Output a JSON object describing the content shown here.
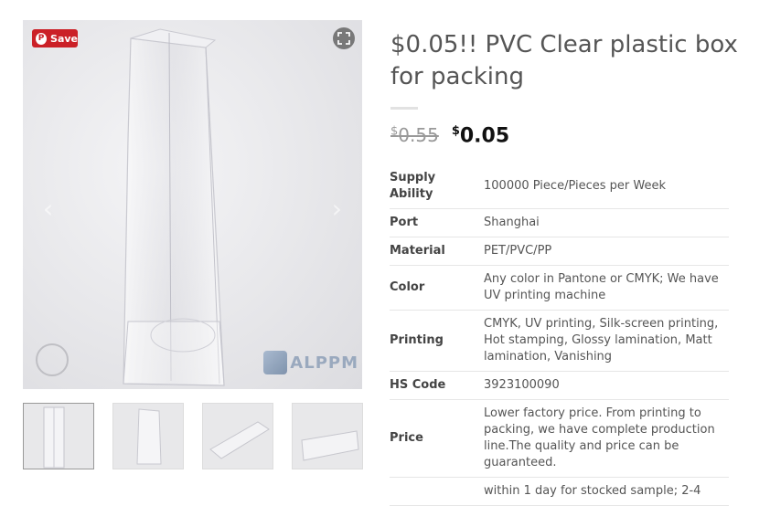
{
  "gallery": {
    "pinterest_save_label": "Save",
    "watermark_text": "ALPPM",
    "thumbnail_count": 4
  },
  "product": {
    "title": "$0.05!! PVC Clear plastic box for packing",
    "price": {
      "currency_symbol": "$",
      "old": "0.55",
      "new": "0.05"
    }
  },
  "specs": [
    {
      "label": "Supply Ability",
      "value": "100000 Piece/Pieces per Week"
    },
    {
      "label": "Port",
      "value": "Shanghai"
    },
    {
      "label": "Material",
      "value": "PET/PVC/PP"
    },
    {
      "label": "Color",
      "value": "Any color in Pantone or CMYK; We have UV printing machine"
    },
    {
      "label": "Printing",
      "value": "CMYK, UV printing, Silk-screen printing, Hot stamping, Glossy lamination, Matt lamination, Vanishing"
    },
    {
      "label": "HS Code",
      "value": "3923100090"
    },
    {
      "label": "Price",
      "value": "Lower factory price. From printing to packing, we have complete production line.The quality and price can be guaranteed."
    },
    {
      "label": "",
      "value": "within 1 day for stocked sample; 2-4"
    }
  ]
}
